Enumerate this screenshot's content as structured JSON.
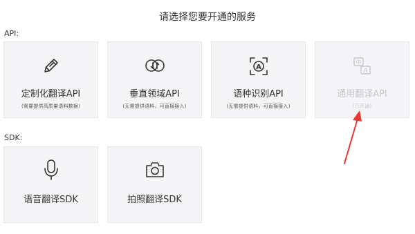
{
  "page": {
    "title": "请选择您要开通的服务"
  },
  "api_section": {
    "label": "API:",
    "cards": [
      {
        "title": "定制化翻译API",
        "subtitle": "(需要提供高质量语料数据)",
        "icon": "pencil-icon",
        "enabled": true
      },
      {
        "title": "垂直领域API",
        "subtitle": "(无需提供语料，可直接接入)",
        "icon": "circular-arrows-icon",
        "enabled": true
      },
      {
        "title": "语种识别API",
        "subtitle": "(无需提供语料，可直接接入)",
        "icon": "language-scan-icon",
        "enabled": true
      },
      {
        "title": "通用翻译API",
        "subtitle": "(已开通)",
        "icon": "translate-icon",
        "enabled": false
      }
    ]
  },
  "sdk_section": {
    "label": "SDK:",
    "cards": [
      {
        "title": "语音翻译SDK",
        "icon": "microphone-icon",
        "enabled": true
      },
      {
        "title": "拍照翻译SDK",
        "icon": "camera-icon",
        "enabled": true
      }
    ]
  },
  "annotation": {
    "icon": "red-arrow-icon",
    "color": "#e53935"
  },
  "translate_icon": {
    "glyph_top": "中",
    "glyph_bottom": "A"
  },
  "language_scan_icon": {
    "glyph": "A"
  },
  "colors": {
    "text": "#333333",
    "disabled": "#c7c7cc",
    "card_bg": "#f5f5f7",
    "card_border": "#e8e8ea",
    "icon": "#333333"
  }
}
